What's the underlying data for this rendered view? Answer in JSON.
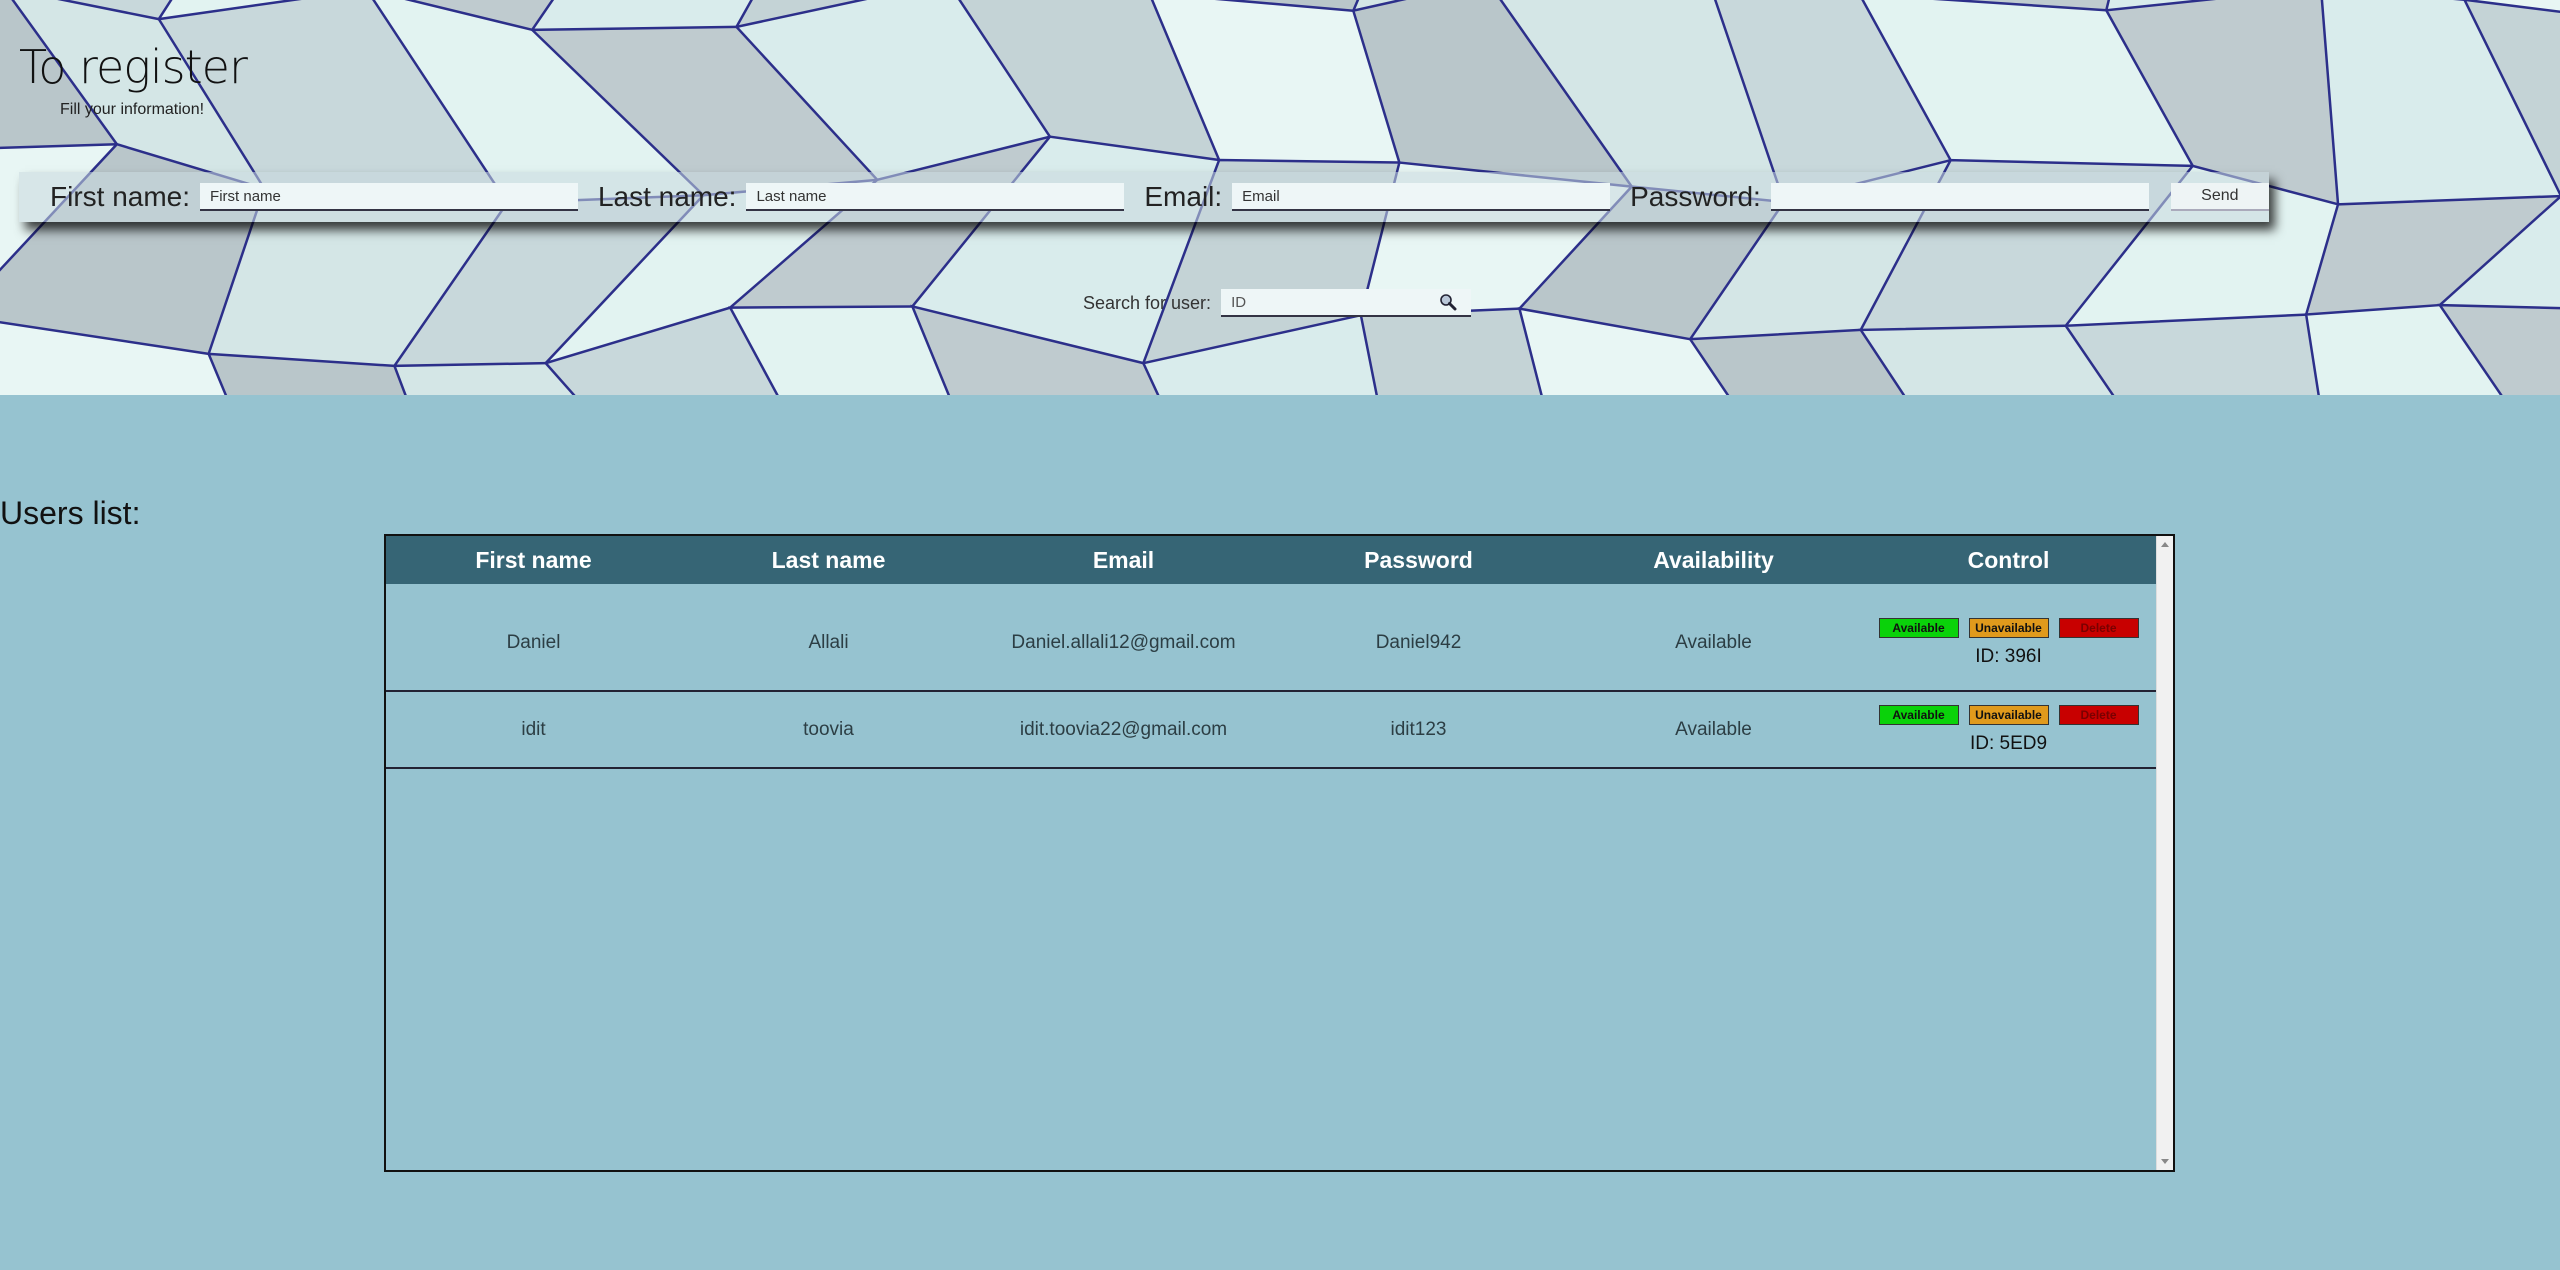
{
  "header": {
    "title": "To register",
    "subtitle": "Fill your information!"
  },
  "register_form": {
    "first_name_label": "First name:",
    "first_name_placeholder": "First name",
    "last_name_label": "Last name:",
    "last_name_placeholder": "Last name",
    "email_label": "Email:",
    "email_placeholder": "Email",
    "password_label": "Password:",
    "password_placeholder": "",
    "send_label": "Send"
  },
  "search": {
    "label": "Search for user:",
    "placeholder": "ID",
    "icon": "search-icon"
  },
  "users_list": {
    "title": "Users list:",
    "columns": [
      "First name",
      "Last name",
      "Email",
      "Password",
      "Availability",
      "Control"
    ],
    "rows": [
      {
        "first_name": "Daniel",
        "last_name": "Allali",
        "email": "Daniel.allali12@gmail.com",
        "password": "Daniel942",
        "availability": "Available",
        "id_text": "ID: 396I"
      },
      {
        "first_name": "idit",
        "last_name": "toovia",
        "email": "idit.toovia22@gmail.com",
        "password": "idit123",
        "availability": "Available",
        "id_text": "ID: 5ED9"
      }
    ],
    "control_buttons": {
      "available": "Available",
      "unavailable": "Unavailable",
      "delete": "Delete"
    }
  },
  "colors": {
    "page_bg": "#96c3d0",
    "table_header": "#366575",
    "available_btn": "#0ad20a",
    "unavailable_btn": "#e09a1c",
    "delete_btn": "#c80000"
  }
}
